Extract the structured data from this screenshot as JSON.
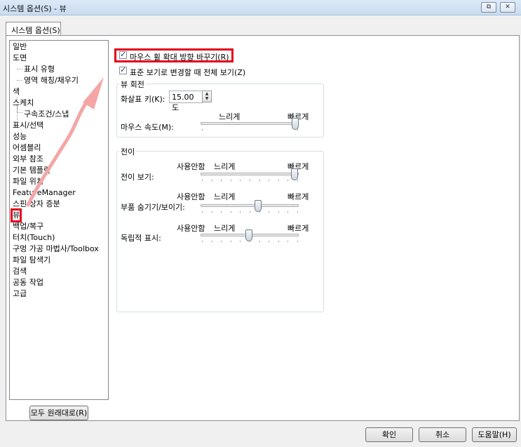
{
  "window": {
    "title": "시스템 옵션(S) - 뷰",
    "btn_restore": "⧉",
    "btn_close": "✕"
  },
  "tab": {
    "label": "시스템 옵션(S)"
  },
  "tree": {
    "items": [
      {
        "label": "일반"
      },
      {
        "label": "도면"
      },
      {
        "label": "표시 유형"
      },
      {
        "label": "영역 해칭/채우기"
      },
      {
        "label": "색"
      },
      {
        "label": "스케치"
      },
      {
        "label": "구속조건/스냅"
      },
      {
        "label": "표시/선택"
      },
      {
        "label": "성능"
      },
      {
        "label": "어셈블리"
      },
      {
        "label": "외부 참조"
      },
      {
        "label": "기본 템플릿"
      },
      {
        "label": "파일 위치"
      },
      {
        "label": "FeatureManager"
      },
      {
        "label": "스핀 상자 증분"
      },
      {
        "label": "뷰"
      },
      {
        "label": "백업/복구"
      },
      {
        "label": "터치(Touch)"
      },
      {
        "label": "구멍 가공 마법사/Toolbox"
      },
      {
        "label": "파일 탐색기"
      },
      {
        "label": "검색"
      },
      {
        "label": "공동 작업"
      },
      {
        "label": "고급"
      }
    ],
    "reset_label": "모두 원래대로(R)"
  },
  "options": {
    "reverse_wheel_zoom": {
      "label": "마우스 휠 확대 방향 바꾸기(R)",
      "checked": true
    },
    "zoom_to_fit": {
      "label": "표준 보기로 변경할 때 전체 보기(Z)",
      "checked": true
    }
  },
  "view_rotation": {
    "title": "뷰 회전",
    "arrow_key_label": "화살표 키(K):",
    "arrow_key_value": "15.00도",
    "mouse_speed_label": "마우스 속도(M):",
    "slow": "느리게",
    "fast": "빠르게",
    "mouse_speed_level": 1.0
  },
  "transition": {
    "title": "전이",
    "rows": [
      {
        "label": "전이 보기:",
        "off": "사용안함",
        "slow": "느리게",
        "fast": "빠르게",
        "level": 1.0
      },
      {
        "label": "부품 숨기기/보이기:",
        "off": "사용안함",
        "slow": "느리게",
        "fast": "빠르게",
        "level": 0.6
      },
      {
        "label": "독립적 표시:",
        "off": "사용안함",
        "slow": "느리게",
        "fast": "빠르게",
        "level": 0.5
      }
    ]
  },
  "footer": {
    "ok": "확인",
    "cancel": "취소",
    "help": "도움말(H)"
  },
  "colors": {
    "highlight": "#e3001b",
    "arrow": "#f4a6a6"
  }
}
